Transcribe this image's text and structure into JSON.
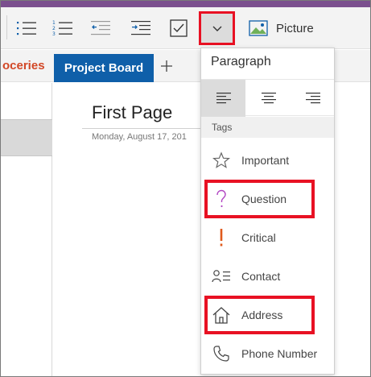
{
  "colors": {
    "accent": "#7b4f8e",
    "tab_active": "#0f5fa9",
    "tab_groceries_text": "#d24726",
    "highlight": "#e81123",
    "important_star": "#666666",
    "question_mark": "#b146c2",
    "critical_mark": "#e05a1c"
  },
  "toolbar": {
    "bullets_icon": "bulleted-list-icon",
    "numbering_icon": "numbered-list-icon",
    "outdent_icon": "decrease-indent-icon",
    "indent_icon": "increase-indent-icon",
    "checkbox_icon": "todo-checkbox-icon",
    "more_icon": "chevron-down-icon",
    "picture_label": "Picture"
  },
  "tabs": {
    "groceries": "oceries",
    "active": "Project Board",
    "add": "+"
  },
  "page": {
    "title": "First Page",
    "date": "Monday, August 17, 201"
  },
  "menu": {
    "heading": "Paragraph",
    "alignments": [
      "align-left",
      "align-center",
      "align-right"
    ],
    "selected_alignment": "align-left",
    "tags_label": "Tags",
    "items": [
      {
        "label": "Important",
        "icon": "star-icon"
      },
      {
        "label": "Question",
        "icon": "question-mark-icon"
      },
      {
        "label": "Critical",
        "icon": "exclamation-icon"
      },
      {
        "label": "Contact",
        "icon": "contact-icon"
      },
      {
        "label": "Address",
        "icon": "home-icon"
      },
      {
        "label": "Phone Number",
        "icon": "phone-icon"
      }
    ]
  }
}
